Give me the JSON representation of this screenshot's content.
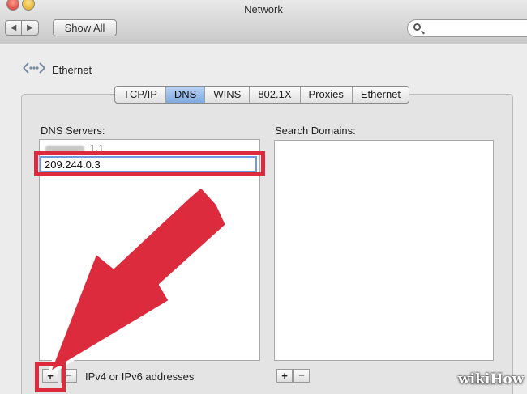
{
  "window": {
    "title": "Network"
  },
  "toolbar": {
    "back_label": "◀",
    "forward_label": "▶",
    "show_all_label": "Show All",
    "search_value": ""
  },
  "header": {
    "interface_name": "Ethernet"
  },
  "tabs": [
    {
      "label": "TCP/IP",
      "active": false
    },
    {
      "label": "DNS",
      "active": true
    },
    {
      "label": "WINS",
      "active": false
    },
    {
      "label": "802.1X",
      "active": false
    },
    {
      "label": "Proxies",
      "active": false
    },
    {
      "label": "Ethernet",
      "active": false
    }
  ],
  "dns": {
    "label": "DNS Servers:",
    "existing_visible_suffix": "1.1",
    "new_entry_value": "209.244.0.3",
    "add_label": "+",
    "remove_label": "−",
    "hint": "IPv4 or IPv6 addresses"
  },
  "search_domains": {
    "label": "Search Domains:",
    "add_label": "+",
    "remove_label": "−"
  },
  "colors": {
    "highlight": "#dd2b3e",
    "selected_tab": "#7fa9e2"
  },
  "watermark": "wikiHow"
}
